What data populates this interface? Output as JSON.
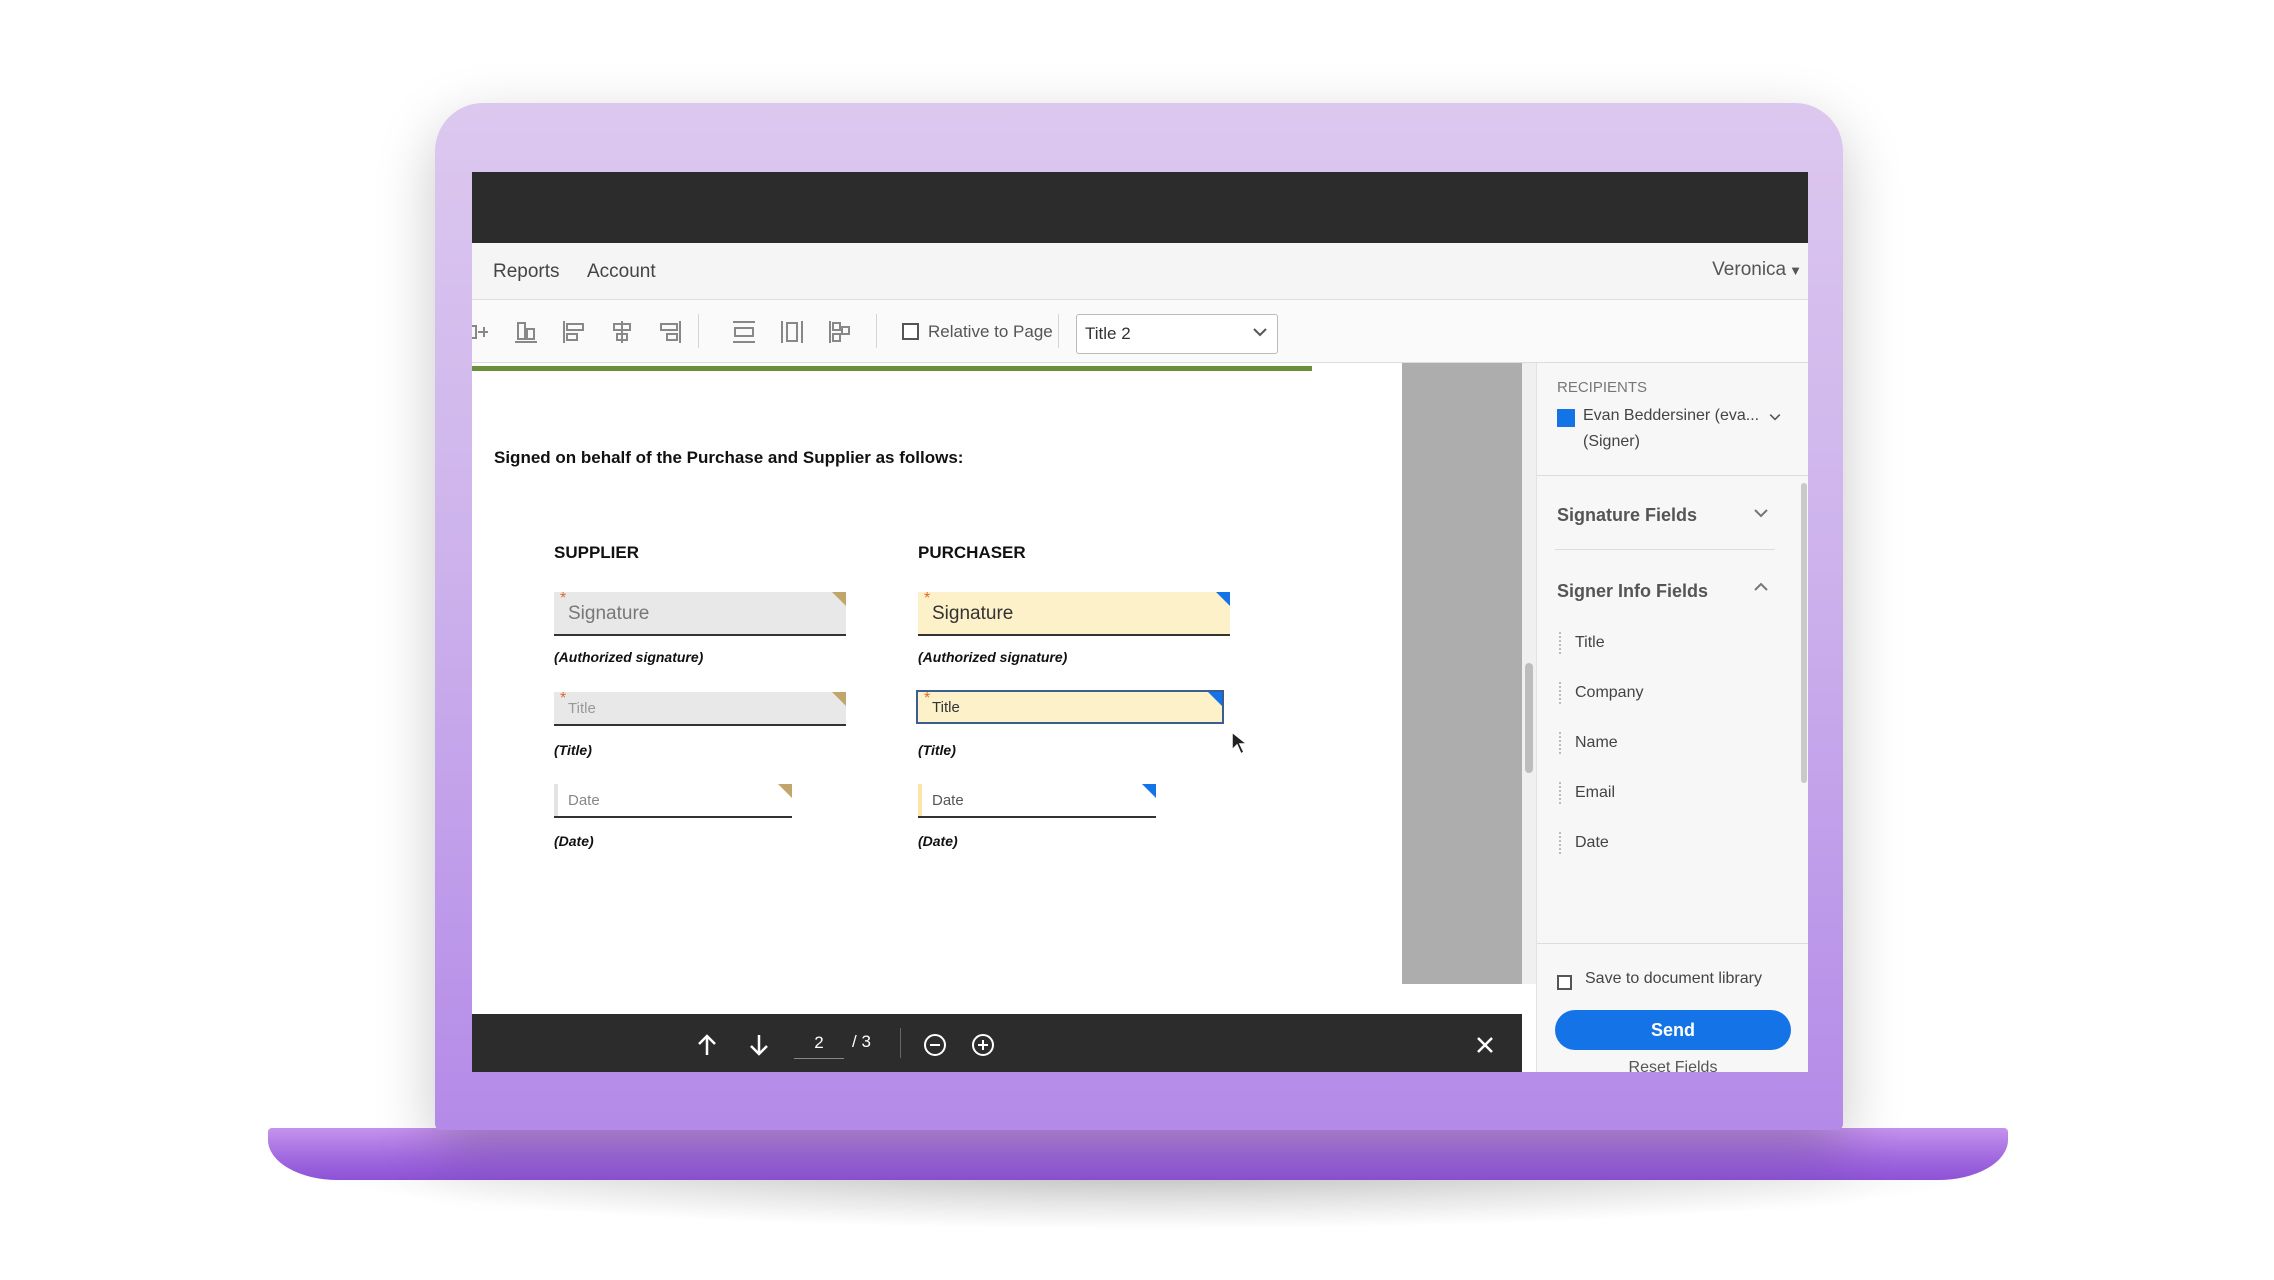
{
  "nav": {
    "reports": "Reports",
    "account": "Account",
    "user": "Veronica"
  },
  "toolbar": {
    "relative_label": "Relative to Page",
    "select_value": "Title 2"
  },
  "document": {
    "heading": "Signed on behalf of the Purchase and Supplier as follows:",
    "supplier": {
      "header": "SUPPLIER",
      "signature_placeholder": "Signature",
      "signature_caption": "(Authorized signature)",
      "title_placeholder": "Title",
      "title_caption": "(Title)",
      "date_placeholder": "Date",
      "date_caption": "(Date)"
    },
    "purchaser": {
      "header": "PURCHASER",
      "signature_placeholder": "Signature",
      "signature_caption": "(Authorized signature)",
      "title_placeholder": "Title",
      "title_caption": "(Title)",
      "date_placeholder": "Date",
      "date_caption": "(Date)"
    }
  },
  "pager": {
    "current_page": "2",
    "total": "/ 3"
  },
  "sidebar": {
    "recipients_label": "RECIPIENTS",
    "recipient_name": "Evan Beddersiner (eva...",
    "recipient_role": "(Signer)",
    "signature_fields": "Signature Fields",
    "signer_info_fields": "Signer Info Fields",
    "signer_items": [
      "Title",
      "Company",
      "Name",
      "Email",
      "Date"
    ],
    "save_label": "Save to document library",
    "send_label": "Send",
    "reset_label": "Reset Fields"
  },
  "colors": {
    "accent": "#1473e6",
    "laptop": "#c9a8ee",
    "field_yellow": "#fdf1c9",
    "field_gray": "#e8e8e8",
    "rule_green": "#6b8e3a"
  },
  "icons": [
    "align-left-icon",
    "align-bottom-icon",
    "align-left-edge-icon",
    "align-center-icon",
    "align-right-icon",
    "distribute-vertical-icon",
    "distribute-horizontal-icon",
    "distribute-grid-icon",
    "chevron-down-icon",
    "arrow-up-icon",
    "arrow-down-icon",
    "zoom-out-icon",
    "zoom-in-icon",
    "close-icon"
  ]
}
